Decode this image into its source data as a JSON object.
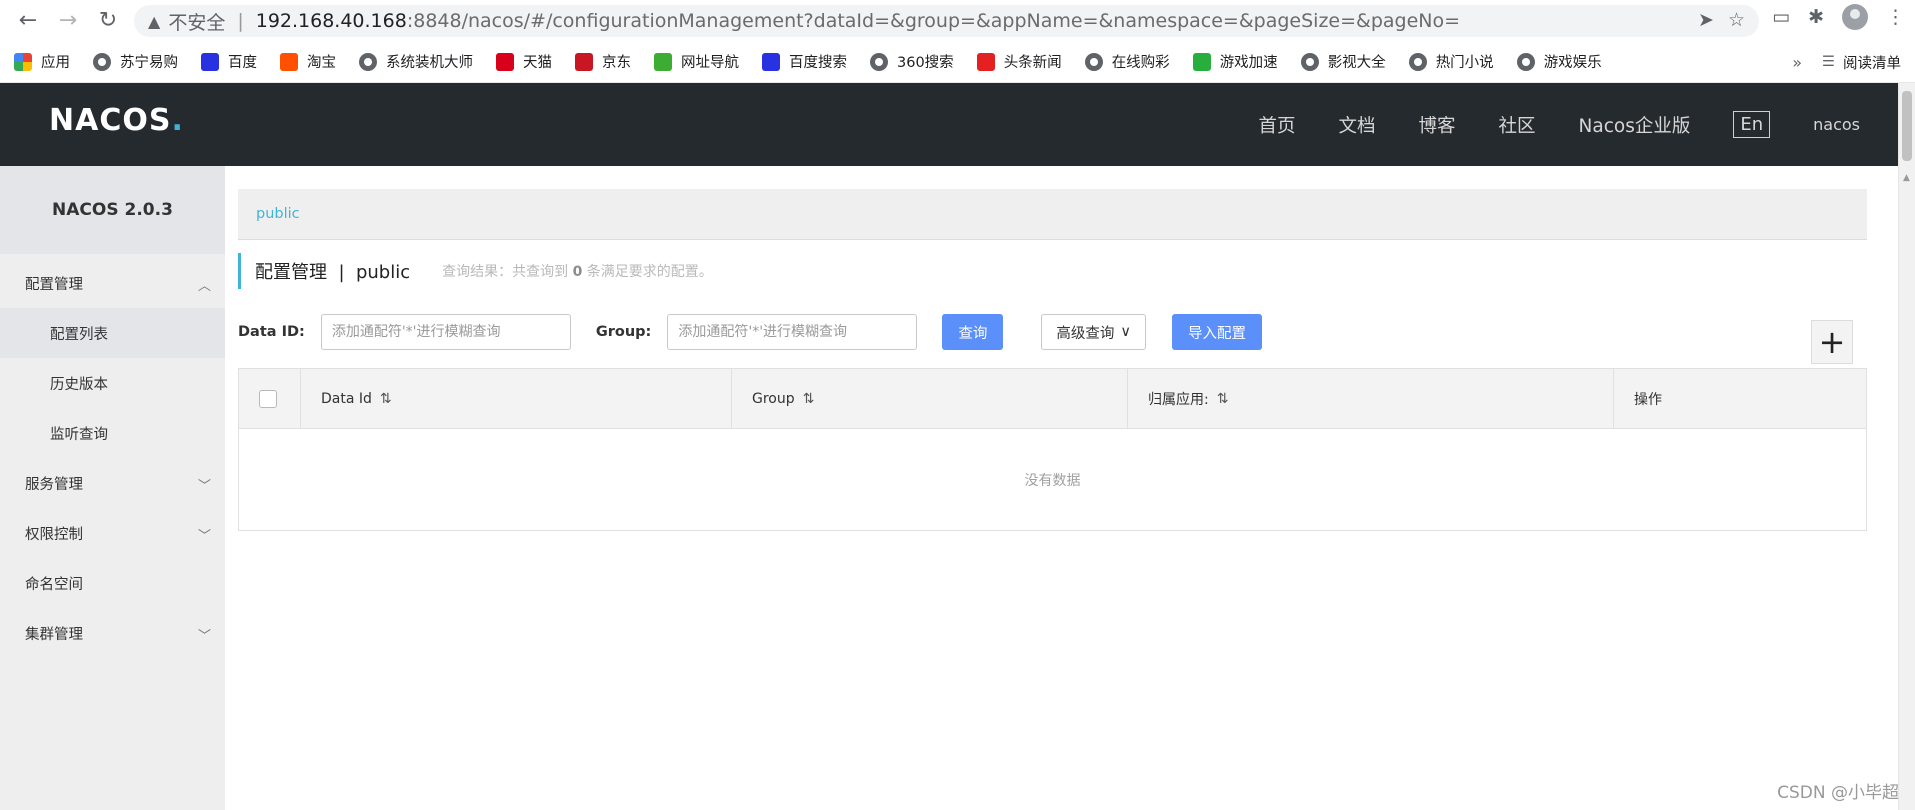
{
  "browser": {
    "insecure_label": "不安全",
    "url_host": "192.168.40.168",
    "url_path": ":8848/nacos/#/configurationManagement?dataId=&group=&appName=&namespace=&pageSize=&pageNo=",
    "bookmarks": [
      {
        "label": "应用",
        "icon": "apps-grid-icon",
        "color": "#1a73e8"
      },
      {
        "label": "苏宁易购",
        "icon": "globe-icon"
      },
      {
        "label": "百度",
        "icon": "baidu-paw-icon",
        "color": "#2932e1"
      },
      {
        "label": "淘宝",
        "icon": "taobao-icon",
        "color": "#ff5000"
      },
      {
        "label": "系统装机大师",
        "icon": "globe-icon"
      },
      {
        "label": "天猫",
        "icon": "tmall-icon",
        "color": "#d8001b"
      },
      {
        "label": "京东",
        "icon": "jd-icon",
        "color": "#c91623"
      },
      {
        "label": "网址导航",
        "icon": "hao-icon",
        "color": "#3dac33"
      },
      {
        "label": "百度搜索",
        "icon": "baidu-paw-icon",
        "color": "#2932e1"
      },
      {
        "label": "360搜索",
        "icon": "globe-icon"
      },
      {
        "label": "头条新闻",
        "icon": "toutiao-icon",
        "color": "#e42020"
      },
      {
        "label": "在线购彩",
        "icon": "globe-icon"
      },
      {
        "label": "游戏加速",
        "icon": "game-speed-icon",
        "color": "#27ae3c"
      },
      {
        "label": "影视大全",
        "icon": "globe-icon"
      },
      {
        "label": "热门小说",
        "icon": "globe-icon"
      },
      {
        "label": "游戏娱乐",
        "icon": "globe-icon"
      }
    ],
    "reading_list": "阅读清单",
    "more": "»"
  },
  "header": {
    "logo": "NACOS",
    "logo_dot": ".",
    "nav": [
      "首页",
      "文档",
      "博客",
      "社区",
      "Nacos企业版"
    ],
    "lang": "En",
    "user": "nacos"
  },
  "sidebar": {
    "brand": "NACOS 2.0.3",
    "config_group": "配置管理",
    "config_items": [
      "配置列表",
      "历史版本",
      "监听查询"
    ],
    "service_group": "服务管理",
    "auth_group": "权限控制",
    "namespace": "命名空间",
    "cluster_group": "集群管理"
  },
  "main": {
    "namespace_tab": "public",
    "title": "配置管理  |  public",
    "result_prefix": "查询结果：共查询到 ",
    "result_count": "0",
    "result_suffix": " 条满足要求的配置。",
    "dataid_label": "Data ID:",
    "dataid_placeholder": "添加通配符'*'进行模糊查询",
    "group_label": "Group:",
    "group_placeholder": "添加通配符'*'进行模糊查询",
    "query_button": "查询",
    "advanced_button": "高级查询",
    "import_button": "导入配置",
    "add_button": "+",
    "columns": [
      "Data Id",
      "Group",
      "归属应用:",
      "操作"
    ],
    "empty_text": "没有数据"
  },
  "watermark": "CSDN @小毕超",
  "colors": {
    "accent": "#3fb5d6",
    "primary": "#5b8ff9",
    "topbar": "#252a2f"
  }
}
